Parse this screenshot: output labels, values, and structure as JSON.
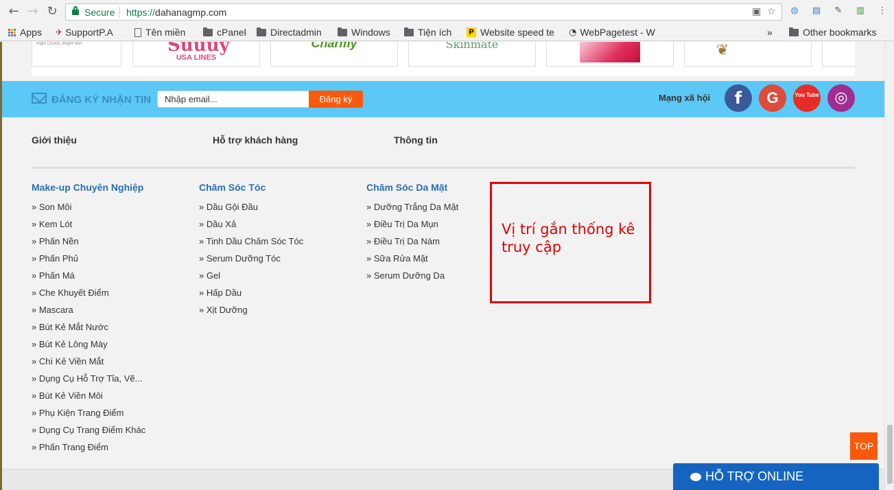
{
  "browser": {
    "secure_label": "Secure",
    "url_scheme": "https://",
    "url_host": "dahanagmp.com"
  },
  "bookmarks": {
    "items": [
      {
        "label": "Apps",
        "icon": "apps-grid-icon"
      },
      {
        "label": "SupportP.A",
        "icon": "supportpa-icon"
      },
      {
        "label": "Tên miền",
        "icon": "page-icon"
      },
      {
        "label": "cPanel",
        "icon": "folder-icon"
      },
      {
        "label": "Directadmin",
        "icon": "folder-icon"
      },
      {
        "label": "Windows",
        "icon": "folder-icon"
      },
      {
        "label": "Tiện ích",
        "icon": "folder-icon"
      },
      {
        "label": "Website speed te",
        "icon": "speed-icon"
      },
      {
        "label": "WebPagetest - W",
        "icon": "gauge-icon"
      }
    ],
    "overflow": "»",
    "other_label": "Other bookmarks"
  },
  "brands": {
    "items": [
      {
        "text": "Right Choice, Bright Skin"
      },
      {
        "text": "USA LINES"
      },
      {
        "text": "Charmy"
      },
      {
        "text": "Skinmate"
      },
      {
        "text": ""
      },
      {
        "text": ""
      }
    ]
  },
  "newsletter": {
    "label": "ĐĂNG KÝ NHẬN TIN",
    "placeholder": "Nhập email...",
    "button": "Đăng ký",
    "social_label": "Mạng xã hội",
    "social": [
      {
        "name": "facebook",
        "glyph": "f",
        "color": "#3b5998"
      },
      {
        "name": "google",
        "glyph": "G",
        "color": "#dd4b39"
      },
      {
        "name": "youtube",
        "glyph": "You Tube",
        "color": "#e52d27"
      },
      {
        "name": "instagram",
        "glyph": "◎",
        "color": "#a02d8f"
      }
    ]
  },
  "footer": {
    "headings": [
      "Giới thiệu",
      "Hỗ trợ khách hàng",
      "Thông tin"
    ],
    "columns": [
      {
        "title": "Make-up Chuyên Nghiệp",
        "items": [
          "» Son Môi",
          "» Kem Lót",
          "» Phấn Nền",
          "» Phấn Phủ",
          "» Phấn Má",
          "» Che Khuyết Điểm",
          "» Mascara",
          "» Bút Kẻ Mắt Nước",
          "» Bút Kẻ Lông Mày",
          "» Chì Kẻ Viền Mắt",
          "» Dụng Cụ Hỗ Trợ Tỉa, Vẽ...",
          "» Bút Kẻ Viền Môi",
          "» Phụ Kiện Trang Điểm",
          "» Dụng Cụ Trang Điểm Khác",
          "» Phấn Trang Điểm"
        ]
      },
      {
        "title": "Chăm Sóc Tóc",
        "items": [
          "» Dầu Gội Đầu",
          "» Dầu Xả",
          "» Tinh Dầu Chăm Sóc Tóc",
          "» Serum Dưỡng Tóc",
          "» Gel",
          "» Hấp Dầu",
          "» Xịt Dưỡng"
        ]
      },
      {
        "title": "Chăm Sóc Da Mặt",
        "items": [
          "» Dưỡng Trắng Da Mặt",
          "» Điều Trị Da Mụn",
          "» Điều Trị Da Nám",
          "» Sữa Rửa Mặt",
          "» Serum Dưỡng Da"
        ]
      }
    ],
    "stats_note": "Vị trí gắn thống kê truy cập"
  },
  "widgets": {
    "top_button": "TOP",
    "support_button": "HỖ TRỢ ONLINE"
  }
}
